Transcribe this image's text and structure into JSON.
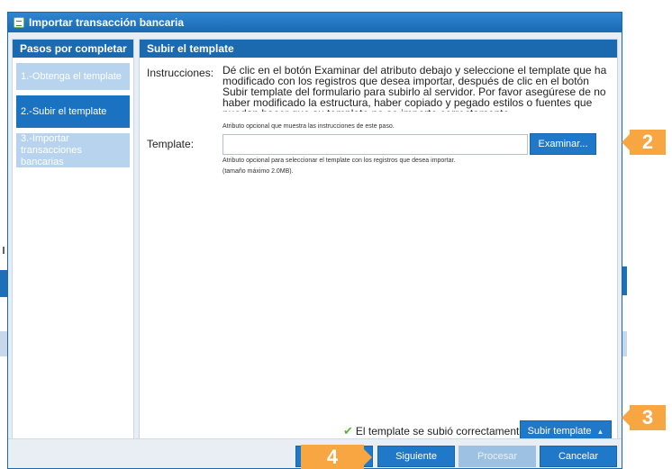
{
  "dialog": {
    "title": "Importar transacción bancaria"
  },
  "steps": {
    "header": "Pasos por completar",
    "items": [
      {
        "label": "1.-Obtenga el template",
        "state": "done"
      },
      {
        "label": "2.-Subir el template",
        "state": "active"
      },
      {
        "label": "3.-Importar transacciones bancarias",
        "state": "pending"
      }
    ]
  },
  "main": {
    "header": "Subir el template",
    "instructions_label": "Instrucciones:",
    "instructions_text": "Dé clic en el botón Examinar del atributo debajo y seleccione el template que ha modificado con los registros que desea importar, después de clic en el botón Subir template del formulario para subirlo al servidor. Por favor asegúrese de no haber modificado la estructura, haber copiado y pegado estilos o fuentes que puedan hacer que su template no se importe correctamente.",
    "instructions_hint": "Atributo opcional que muestra las instrucciones de este paso.",
    "template_label": "Template:",
    "template_value": "",
    "browse_button": "Examinar...",
    "template_hint_1": "Atributo opcional para seleccionar el template con los registros que desea importar.",
    "template_hint_2": "(tamaño máximo 2.0MB).",
    "success_message": "El template se subió correctamente.",
    "upload_button": "Subir template"
  },
  "footer": {
    "next_button": "Siguiente",
    "process_button": "Procesar",
    "cancel_button": "Cancelar"
  },
  "callouts": [
    "2",
    "3",
    "4"
  ],
  "colors": {
    "primary": "#1b6ab0",
    "button": "#1f78c8",
    "callout": "#f7a642",
    "step_inactive": "#b7d3ee",
    "success_icon": "#5cb33a"
  }
}
